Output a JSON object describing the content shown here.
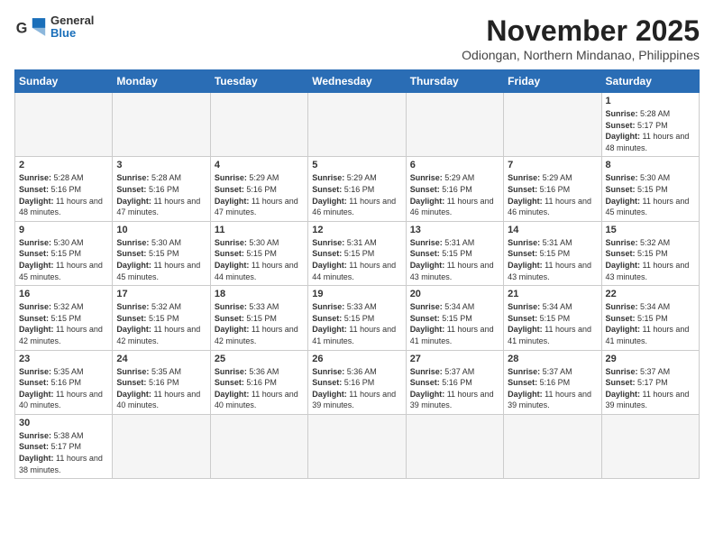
{
  "header": {
    "logo_text_general": "General",
    "logo_text_blue": "Blue",
    "month_title": "November 2025",
    "location": "Odiongan, Northern Mindanao, Philippines"
  },
  "weekdays": [
    "Sunday",
    "Monday",
    "Tuesday",
    "Wednesday",
    "Thursday",
    "Friday",
    "Saturday"
  ],
  "weeks": [
    [
      {
        "day": "",
        "empty": true
      },
      {
        "day": "",
        "empty": true
      },
      {
        "day": "",
        "empty": true
      },
      {
        "day": "",
        "empty": true
      },
      {
        "day": "",
        "empty": true
      },
      {
        "day": "",
        "empty": true
      },
      {
        "day": "1",
        "sunrise": "5:28 AM",
        "sunset": "5:17 PM",
        "daylight": "11 hours and 48 minutes."
      }
    ],
    [
      {
        "day": "2",
        "sunrise": "5:28 AM",
        "sunset": "5:16 PM",
        "daylight": "11 hours and 48 minutes."
      },
      {
        "day": "3",
        "sunrise": "5:28 AM",
        "sunset": "5:16 PM",
        "daylight": "11 hours and 47 minutes."
      },
      {
        "day": "4",
        "sunrise": "5:29 AM",
        "sunset": "5:16 PM",
        "daylight": "11 hours and 47 minutes."
      },
      {
        "day": "5",
        "sunrise": "5:29 AM",
        "sunset": "5:16 PM",
        "daylight": "11 hours and 46 minutes."
      },
      {
        "day": "6",
        "sunrise": "5:29 AM",
        "sunset": "5:16 PM",
        "daylight": "11 hours and 46 minutes."
      },
      {
        "day": "7",
        "sunrise": "5:29 AM",
        "sunset": "5:16 PM",
        "daylight": "11 hours and 46 minutes."
      },
      {
        "day": "8",
        "sunrise": "5:30 AM",
        "sunset": "5:15 PM",
        "daylight": "11 hours and 45 minutes."
      }
    ],
    [
      {
        "day": "9",
        "sunrise": "5:30 AM",
        "sunset": "5:15 PM",
        "daylight": "11 hours and 45 minutes."
      },
      {
        "day": "10",
        "sunrise": "5:30 AM",
        "sunset": "5:15 PM",
        "daylight": "11 hours and 45 minutes."
      },
      {
        "day": "11",
        "sunrise": "5:30 AM",
        "sunset": "5:15 PM",
        "daylight": "11 hours and 44 minutes."
      },
      {
        "day": "12",
        "sunrise": "5:31 AM",
        "sunset": "5:15 PM",
        "daylight": "11 hours and 44 minutes."
      },
      {
        "day": "13",
        "sunrise": "5:31 AM",
        "sunset": "5:15 PM",
        "daylight": "11 hours and 43 minutes."
      },
      {
        "day": "14",
        "sunrise": "5:31 AM",
        "sunset": "5:15 PM",
        "daylight": "11 hours and 43 minutes."
      },
      {
        "day": "15",
        "sunrise": "5:32 AM",
        "sunset": "5:15 PM",
        "daylight": "11 hours and 43 minutes."
      }
    ],
    [
      {
        "day": "16",
        "sunrise": "5:32 AM",
        "sunset": "5:15 PM",
        "daylight": "11 hours and 42 minutes."
      },
      {
        "day": "17",
        "sunrise": "5:32 AM",
        "sunset": "5:15 PM",
        "daylight": "11 hours and 42 minutes."
      },
      {
        "day": "18",
        "sunrise": "5:33 AM",
        "sunset": "5:15 PM",
        "daylight": "11 hours and 42 minutes."
      },
      {
        "day": "19",
        "sunrise": "5:33 AM",
        "sunset": "5:15 PM",
        "daylight": "11 hours and 41 minutes."
      },
      {
        "day": "20",
        "sunrise": "5:34 AM",
        "sunset": "5:15 PM",
        "daylight": "11 hours and 41 minutes."
      },
      {
        "day": "21",
        "sunrise": "5:34 AM",
        "sunset": "5:15 PM",
        "daylight": "11 hours and 41 minutes."
      },
      {
        "day": "22",
        "sunrise": "5:34 AM",
        "sunset": "5:15 PM",
        "daylight": "11 hours and 41 minutes."
      }
    ],
    [
      {
        "day": "23",
        "sunrise": "5:35 AM",
        "sunset": "5:16 PM",
        "daylight": "11 hours and 40 minutes."
      },
      {
        "day": "24",
        "sunrise": "5:35 AM",
        "sunset": "5:16 PM",
        "daylight": "11 hours and 40 minutes."
      },
      {
        "day": "25",
        "sunrise": "5:36 AM",
        "sunset": "5:16 PM",
        "daylight": "11 hours and 40 minutes."
      },
      {
        "day": "26",
        "sunrise": "5:36 AM",
        "sunset": "5:16 PM",
        "daylight": "11 hours and 39 minutes."
      },
      {
        "day": "27",
        "sunrise": "5:37 AM",
        "sunset": "5:16 PM",
        "daylight": "11 hours and 39 minutes."
      },
      {
        "day": "28",
        "sunrise": "5:37 AM",
        "sunset": "5:16 PM",
        "daylight": "11 hours and 39 minutes."
      },
      {
        "day": "29",
        "sunrise": "5:37 AM",
        "sunset": "5:17 PM",
        "daylight": "11 hours and 39 minutes."
      }
    ],
    [
      {
        "day": "30",
        "sunrise": "5:38 AM",
        "sunset": "5:17 PM",
        "daylight": "11 hours and 38 minutes."
      },
      {
        "day": "",
        "empty": true
      },
      {
        "day": "",
        "empty": true
      },
      {
        "day": "",
        "empty": true
      },
      {
        "day": "",
        "empty": true
      },
      {
        "day": "",
        "empty": true
      },
      {
        "day": "",
        "empty": true
      }
    ]
  ],
  "labels": {
    "sunrise": "Sunrise: ",
    "sunset": "Sunset: ",
    "daylight": "Daylight: "
  }
}
